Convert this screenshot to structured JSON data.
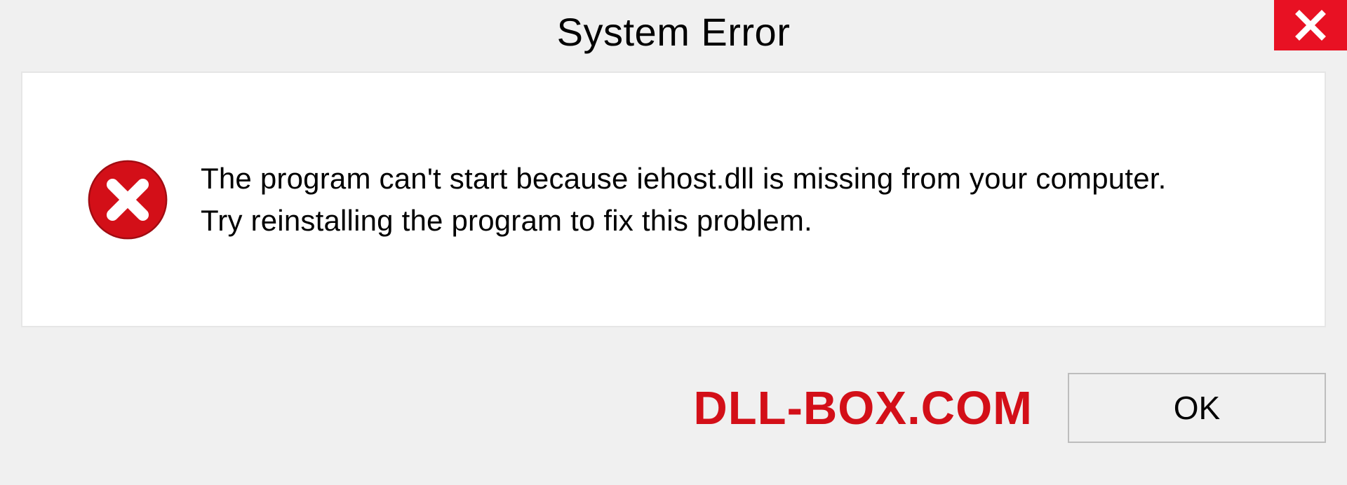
{
  "dialog": {
    "title": "System Error",
    "message_line1": "The program can't start because iehost.dll is missing from your computer.",
    "message_line2": "Try reinstalling the program to fix this problem.",
    "ok_label": "OK"
  },
  "watermark": {
    "text": "DLL-BOX.COM"
  },
  "colors": {
    "close_bg": "#e81123",
    "error_red": "#d30f18",
    "panel_bg": "#ffffff",
    "page_bg": "#f0f0f0"
  }
}
